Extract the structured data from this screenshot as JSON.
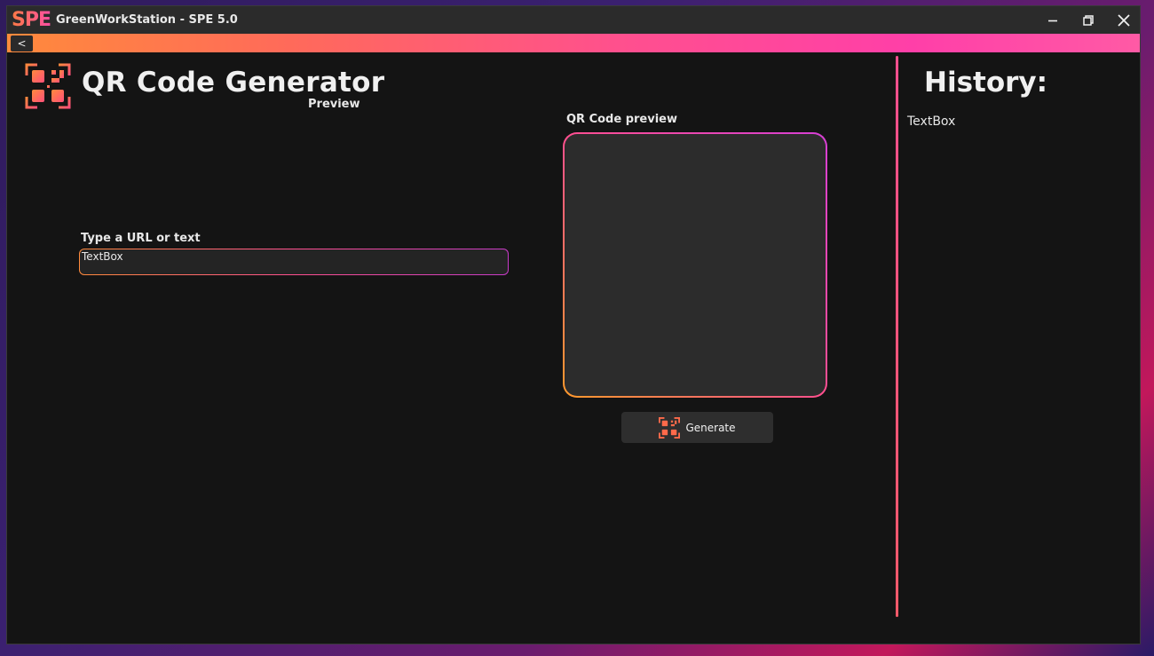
{
  "window": {
    "logo": "SPE",
    "title": "GreenWorkStation - SPE 5.0",
    "back_label": "<"
  },
  "icons": {
    "minimize": "minimize-icon",
    "maximize": "restore-icon",
    "close": "close-icon",
    "app": "qr-code-icon"
  },
  "main": {
    "title": "QR Code Generator",
    "preview_label": "Preview",
    "input": {
      "label": "Type a URL or text",
      "value": "TextBox"
    },
    "qr": {
      "label": "QR Code preview"
    },
    "generate_label": "Generate"
  },
  "history": {
    "title": "History:",
    "items": [
      "TextBox"
    ]
  },
  "colors": {
    "background": "#141414",
    "titlebar": "#2b2b2b",
    "accent_start": "#ff8a3c",
    "accent_end": "#ff3fa8",
    "panel": "#2c2c2c"
  }
}
